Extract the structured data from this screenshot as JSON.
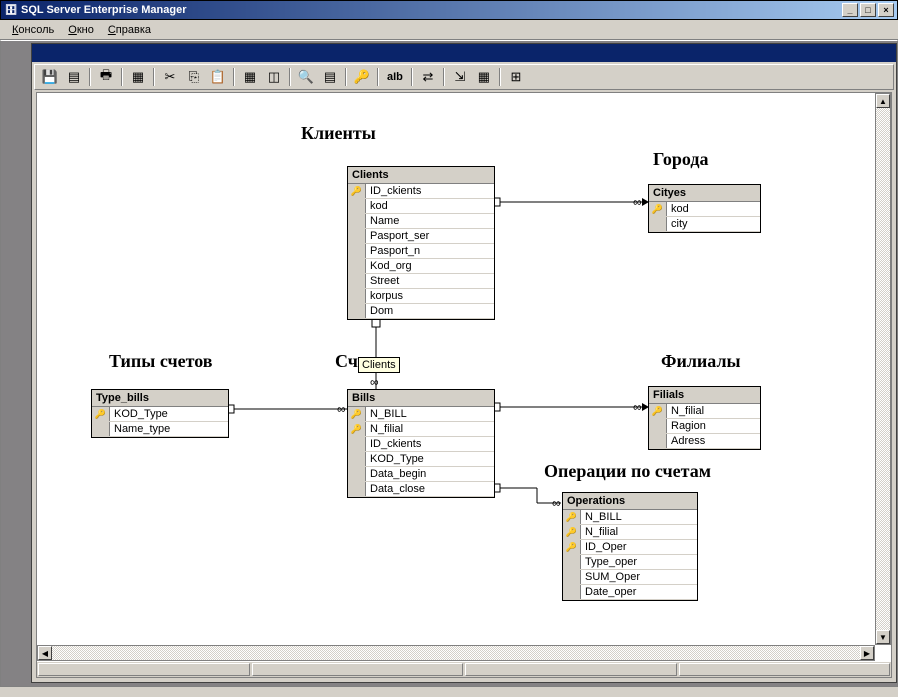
{
  "window": {
    "title": "SQL Server Enterprise Manager"
  },
  "menu": {
    "console": "Консоль",
    "window": "Окно",
    "help": "Справка"
  },
  "toolbar": {
    "ab_label": "aIb"
  },
  "labels": {
    "clients": "Клиенты",
    "cities": "Города",
    "bill_types": "Типы счетов",
    "accounts": "Сч",
    "branches": "Филиалы",
    "operations": "Операции по счетам"
  },
  "tooltip": "Clients",
  "tables": {
    "clients": {
      "name": "Clients",
      "cols": [
        {
          "k": true,
          "n": "ID_ckients"
        },
        {
          "k": false,
          "n": "kod"
        },
        {
          "k": false,
          "n": "Name"
        },
        {
          "k": false,
          "n": "Pasport_ser"
        },
        {
          "k": false,
          "n": "Pasport_n"
        },
        {
          "k": false,
          "n": "Kod_org"
        },
        {
          "k": false,
          "n": "Street"
        },
        {
          "k": false,
          "n": "korpus"
        },
        {
          "k": false,
          "n": "Dom"
        }
      ]
    },
    "cityes": {
      "name": "Cityes",
      "cols": [
        {
          "k": true,
          "n": "kod"
        },
        {
          "k": false,
          "n": "city"
        }
      ]
    },
    "type_bills": {
      "name": "Type_bills",
      "cols": [
        {
          "k": true,
          "n": "KOD_Type"
        },
        {
          "k": false,
          "n": "Name_type"
        }
      ]
    },
    "bills": {
      "name": "Bills",
      "cols": [
        {
          "k": true,
          "n": "N_BILL"
        },
        {
          "k": true,
          "n": "N_filial"
        },
        {
          "k": false,
          "n": "ID_ckients"
        },
        {
          "k": false,
          "n": "KOD_Type"
        },
        {
          "k": false,
          "n": "Data_begin"
        },
        {
          "k": false,
          "n": "Data_close"
        }
      ]
    },
    "filials": {
      "name": "Filials",
      "cols": [
        {
          "k": true,
          "n": "N_filial"
        },
        {
          "k": false,
          "n": "Ragion"
        },
        {
          "k": false,
          "n": "Adress"
        }
      ]
    },
    "operations": {
      "name": "Operations",
      "cols": [
        {
          "k": true,
          "n": "N_BILL"
        },
        {
          "k": true,
          "n": "N_filial"
        },
        {
          "k": true,
          "n": "ID_Oper"
        },
        {
          "k": false,
          "n": "Type_oper"
        },
        {
          "k": false,
          "n": "SUM_Oper"
        },
        {
          "k": false,
          "n": "Date_oper"
        }
      ]
    }
  }
}
